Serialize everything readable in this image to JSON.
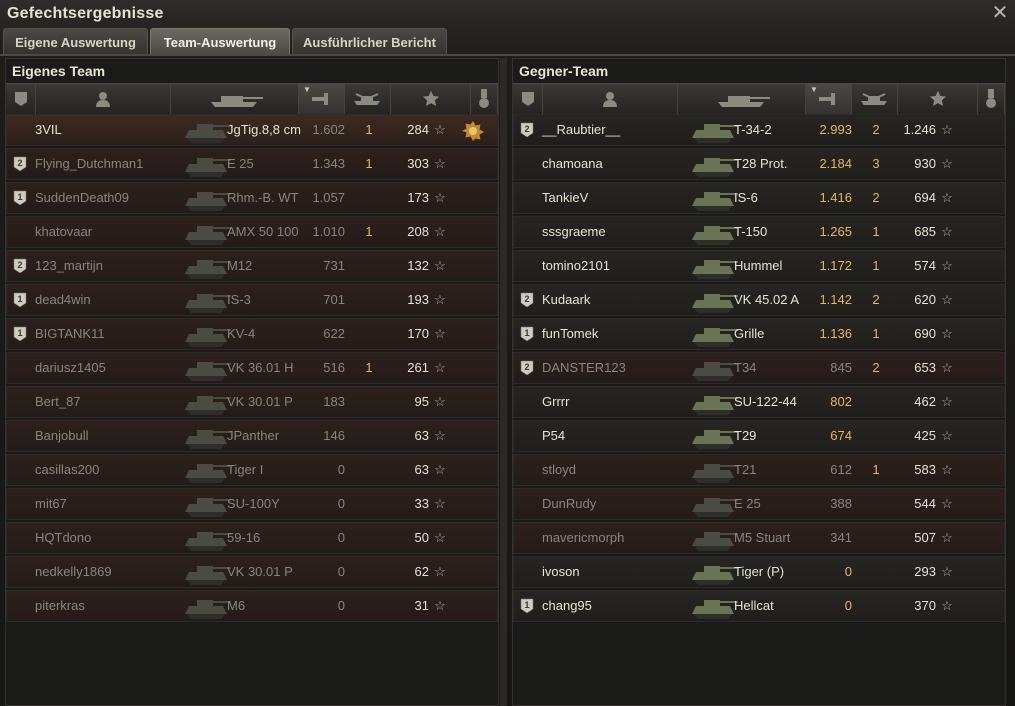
{
  "window": {
    "title": "Gefechtsergebnisse",
    "close_icon": "close-icon"
  },
  "tabs": [
    {
      "label": "Eigene Auswertung",
      "active": false
    },
    {
      "label": "Team-Auswertung",
      "active": true
    },
    {
      "label": "Ausführlicher Bericht",
      "active": false
    }
  ],
  "columns": [
    "platoon-icon",
    "player-icon",
    "tank-icon",
    "xp-icon",
    "kills-icon",
    "damage-star-icon",
    "medal-icon"
  ],
  "own_team": {
    "title": "Eigenes Team",
    "rows": [
      {
        "platoon": "",
        "name": "3VIL",
        "tank": "JgTig.8,8 cm",
        "xp": "1.602",
        "kills": "1",
        "damage": "284",
        "state": "player",
        "medal": true
      },
      {
        "platoon": "2",
        "name": "Flying_Dutchman1",
        "tank": "E 25",
        "xp": "1.343",
        "kills": "1",
        "damage": "303",
        "state": "dead",
        "medal": false
      },
      {
        "platoon": "1",
        "name": "SuddenDeath09",
        "tank": "Rhm.-B. WT",
        "xp": "1.057",
        "kills": "",
        "damage": "173",
        "state": "dead",
        "medal": false
      },
      {
        "platoon": "",
        "name": "khatovaar",
        "tank": "AMX 50 100",
        "xp": "1.010",
        "kills": "1",
        "damage": "208",
        "state": "dead",
        "medal": false
      },
      {
        "platoon": "2",
        "name": "123_martijn",
        "tank": "M12",
        "xp": "731",
        "kills": "",
        "damage": "132",
        "state": "dead",
        "medal": false
      },
      {
        "platoon": "1",
        "name": "dead4win",
        "tank": "IS-3",
        "xp": "701",
        "kills": "",
        "damage": "193",
        "state": "dead",
        "medal": false
      },
      {
        "platoon": "1",
        "name": "BIGTANK11",
        "tank": "KV-4",
        "xp": "622",
        "kills": "",
        "damage": "170",
        "state": "dead",
        "medal": false
      },
      {
        "platoon": "",
        "name": "dariusz1405",
        "tank": "VK 36.01 H",
        "xp": "516",
        "kills": "1",
        "damage": "261",
        "state": "dead",
        "medal": false
      },
      {
        "platoon": "",
        "name": "Bert_87",
        "tank": "VK 30.01 P",
        "xp": "183",
        "kills": "",
        "damage": "95",
        "state": "dead",
        "medal": false
      },
      {
        "platoon": "",
        "name": "Banjobull",
        "tank": "JPanther",
        "xp": "146",
        "kills": "",
        "damage": "63",
        "state": "dead",
        "medal": false
      },
      {
        "platoon": "",
        "name": "casillas200",
        "tank": "Tiger I",
        "xp": "0",
        "kills": "",
        "damage": "63",
        "state": "dead",
        "medal": false
      },
      {
        "platoon": "",
        "name": "mit67",
        "tank": "SU-100Y",
        "xp": "0",
        "kills": "",
        "damage": "33",
        "state": "dead",
        "medal": false
      },
      {
        "platoon": "",
        "name": "HQTdono",
        "tank": "59-16",
        "xp": "0",
        "kills": "",
        "damage": "50",
        "state": "dead",
        "medal": false
      },
      {
        "platoon": "",
        "name": "nedkelly1869",
        "tank": "VK 30.01 P",
        "xp": "0",
        "kills": "",
        "damage": "62",
        "state": "dead",
        "medal": false
      },
      {
        "platoon": "",
        "name": "piterkras",
        "tank": "M6",
        "xp": "0",
        "kills": "",
        "damage": "31",
        "state": "dead",
        "medal": false
      }
    ]
  },
  "enemy_team": {
    "title": "Gegner-Team",
    "rows": [
      {
        "platoon": "2",
        "name": "__Raubtier__",
        "tank": "T-34-2",
        "xp": "2.993",
        "kills": "2",
        "damage": "1.246",
        "state": "alive",
        "medal": false
      },
      {
        "platoon": "",
        "name": "chamoana",
        "tank": "T28 Prot.",
        "xp": "2.184",
        "kills": "3",
        "damage": "930",
        "state": "alive",
        "medal": false
      },
      {
        "platoon": "",
        "name": "TankieV",
        "tank": "IS-6",
        "xp": "1.416",
        "kills": "2",
        "damage": "694",
        "state": "alive",
        "medal": false
      },
      {
        "platoon": "",
        "name": "sssgraeme",
        "tank": "T-150",
        "xp": "1.265",
        "kills": "1",
        "damage": "685",
        "state": "alive",
        "medal": false
      },
      {
        "platoon": "",
        "name": "tomino2101",
        "tank": "Hummel",
        "xp": "1.172",
        "kills": "1",
        "damage": "574",
        "state": "alive",
        "medal": false
      },
      {
        "platoon": "2",
        "name": "Kudaark",
        "tank": "VK 45.02 A",
        "xp": "1.142",
        "kills": "2",
        "damage": "620",
        "state": "alive",
        "medal": false
      },
      {
        "platoon": "1",
        "name": "funTomek",
        "tank": "Grille",
        "xp": "1.136",
        "kills": "1",
        "damage": "690",
        "state": "alive",
        "medal": false
      },
      {
        "platoon": "2",
        "name": "DANSTER123",
        "tank": "T34",
        "xp": "845",
        "kills": "2",
        "damage": "653",
        "state": "dead",
        "medal": false
      },
      {
        "platoon": "",
        "name": "Grrrr",
        "tank": "SU-122-44",
        "xp": "802",
        "kills": "",
        "damage": "462",
        "state": "alive",
        "medal": false
      },
      {
        "platoon": "",
        "name": "P54",
        "tank": "T29",
        "xp": "674",
        "kills": "",
        "damage": "425",
        "state": "alive",
        "medal": false
      },
      {
        "platoon": "",
        "name": "stloyd",
        "tank": "T21",
        "xp": "612",
        "kills": "1",
        "damage": "583",
        "state": "dead",
        "medal": false
      },
      {
        "platoon": "",
        "name": "DunRudy",
        "tank": "E 25",
        "xp": "388",
        "kills": "",
        "damage": "544",
        "state": "dead",
        "medal": false
      },
      {
        "platoon": "",
        "name": "mavericmorph",
        "tank": "M5 Stuart",
        "xp": "341",
        "kills": "",
        "damage": "507",
        "state": "dead",
        "medal": false
      },
      {
        "platoon": "",
        "name": "ivoson",
        "tank": "Tiger (P)",
        "xp": "0",
        "kills": "",
        "damage": "293",
        "state": "alive",
        "medal": false
      },
      {
        "platoon": "1",
        "name": "chang95",
        "tank": "Hellcat",
        "xp": "0",
        "kills": "",
        "damage": "370",
        "state": "alive",
        "medal": false
      }
    ]
  },
  "colors": {
    "xp_alive": "#e6b660",
    "text": "#e6e2d4",
    "dead_text": "#8a857a",
    "player_row": "#3d2a22"
  }
}
